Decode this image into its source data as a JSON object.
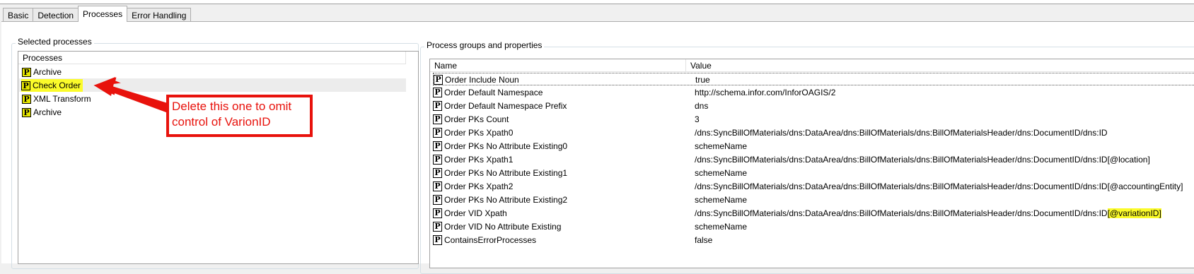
{
  "tabs": [
    {
      "label": "Basic",
      "active": false
    },
    {
      "label": "Detection",
      "active": false
    },
    {
      "label": "Processes",
      "active": true
    },
    {
      "label": "Error Handling",
      "active": false
    }
  ],
  "selected_processes": {
    "group_title": "Selected processes",
    "column_header": "Processes",
    "items": [
      {
        "label": "Archive",
        "selected": false,
        "highlighted": false
      },
      {
        "label": "Check Order",
        "selected": true,
        "highlighted": true
      },
      {
        "label": "XML Transform",
        "selected": false,
        "highlighted": false
      },
      {
        "label": "Archive",
        "selected": false,
        "highlighted": false
      }
    ]
  },
  "annotation": {
    "text": "Delete this one to omit control of VarionID",
    "color": "#e8120c"
  },
  "process_groups": {
    "group_title": "Process groups and properties",
    "columns": [
      "Name",
      "Value"
    ],
    "rows": [
      {
        "name": "Order Include Noun",
        "value": "true"
      },
      {
        "name": "Order Default Namespace",
        "value": "http://schema.infor.com/InforOAGIS/2"
      },
      {
        "name": "Order Default Namespace Prefix",
        "value": "dns"
      },
      {
        "name": "Order PKs Count",
        "value": "3"
      },
      {
        "name": "Order PKs Xpath0",
        "value": "/dns:SyncBillOfMaterials/dns:DataArea/dns:BillOfMaterials/dns:BillOfMaterialsHeader/dns:DocumentID/dns:ID"
      },
      {
        "name": "Order PKs No Attribute Existing0",
        "value": "schemeName"
      },
      {
        "name": "Order PKs Xpath1",
        "value": "/dns:SyncBillOfMaterials/dns:DataArea/dns:BillOfMaterials/dns:BillOfMaterialsHeader/dns:DocumentID/dns:ID[@location]"
      },
      {
        "name": "Order PKs No Attribute Existing1",
        "value": "schemeName"
      },
      {
        "name": "Order PKs Xpath2",
        "value": "/dns:SyncBillOfMaterials/dns:DataArea/dns:BillOfMaterials/dns:BillOfMaterialsHeader/dns:DocumentID/dns:ID[@accountingEntity]"
      },
      {
        "name": "Order PKs No Attribute Existing2",
        "value": "schemeName"
      },
      {
        "name": "Order VID Xpath",
        "value": "/dns:SyncBillOfMaterials/dns:DataArea/dns:BillOfMaterials/dns:BillOfMaterialsHeader/dns:DocumentID/dns:ID",
        "value_highlight": "[@variationID]"
      },
      {
        "name": "Order VID No Attribute Existing",
        "value": "schemeName"
      },
      {
        "name": "ContainsErrorProcesses",
        "value": "false"
      }
    ]
  },
  "colors": {
    "highlight": "#fbfb2a",
    "accent_red": "#e8120c",
    "icon_yellow": "#e6e600"
  },
  "icons": {
    "process": "P-icon"
  }
}
